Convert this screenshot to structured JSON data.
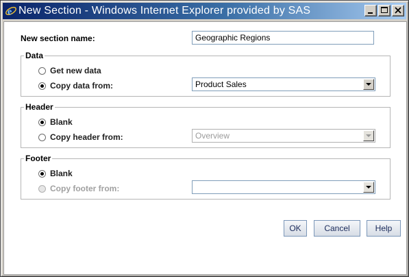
{
  "window": {
    "title": "New Section - Windows Internet Explorer provided by SAS"
  },
  "form": {
    "section_name_label": "New section name:",
    "section_name_value": "Geographic Regions"
  },
  "data_group": {
    "legend": "Data",
    "option_new": "Get new data",
    "option_copy": "Copy data from:",
    "selected": "copy",
    "copy_select_value": "Product Sales"
  },
  "header_group": {
    "legend": "Header",
    "option_blank": "Blank",
    "option_copy": "Copy header from:",
    "selected": "blank",
    "copy_select_value": "Overview"
  },
  "footer_group": {
    "legend": "Footer",
    "option_blank": "Blank",
    "option_copy": "Copy footer from:",
    "selected": "blank",
    "copy_select_value": ""
  },
  "buttons": {
    "ok": "OK",
    "cancel": "Cancel",
    "help": "Help"
  }
}
